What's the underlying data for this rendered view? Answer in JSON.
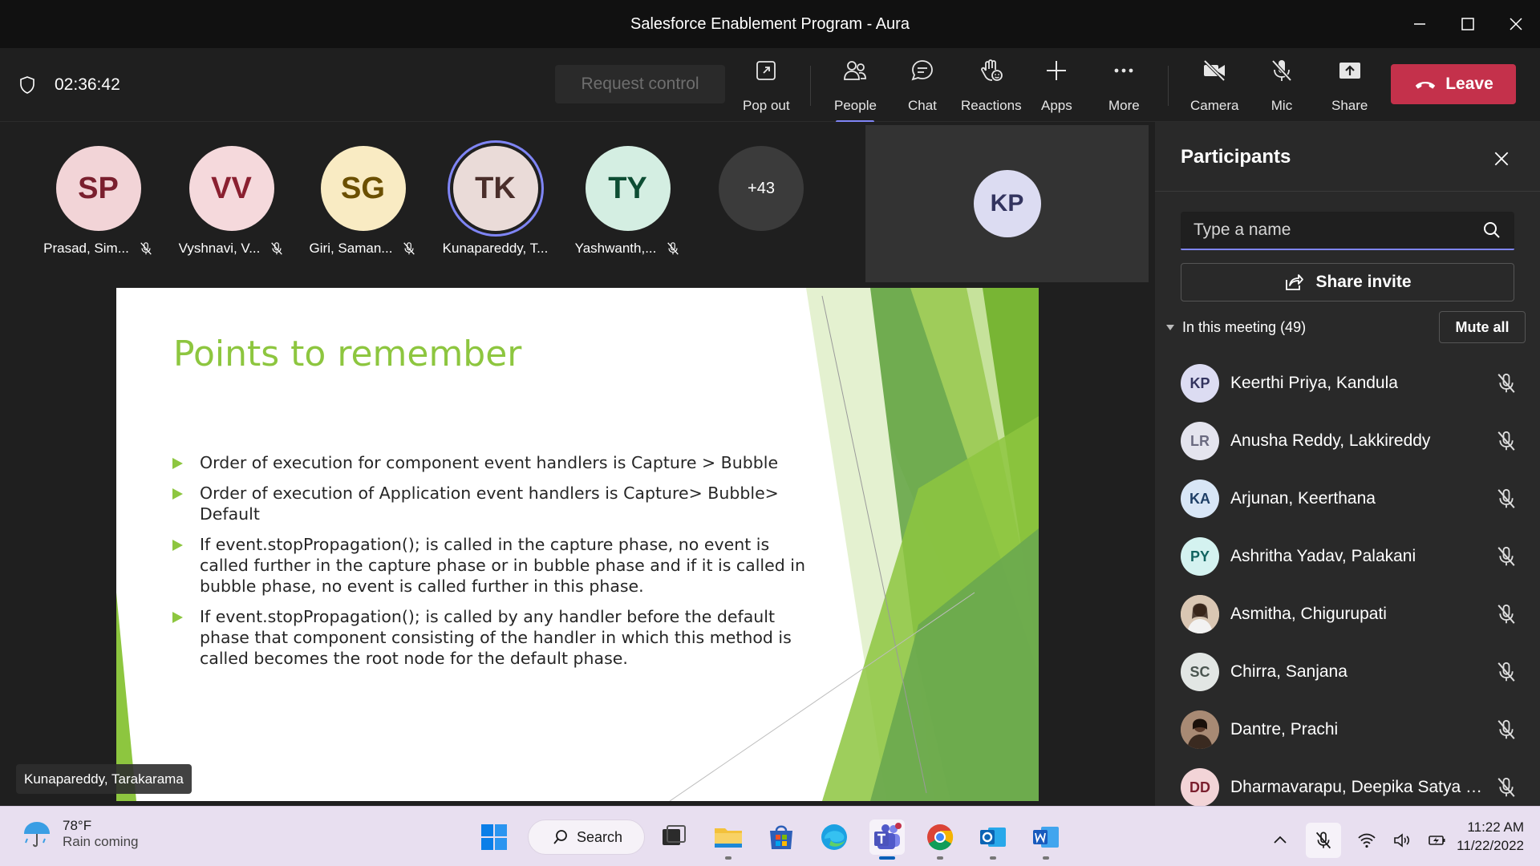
{
  "window": {
    "title": "Salesforce Enablement Program - Aura"
  },
  "toolbar": {
    "timer": "02:36:42",
    "request_control": "Request control",
    "buttons": {
      "pop_out": "Pop out",
      "people": "People",
      "chat": "Chat",
      "reactions": "Reactions",
      "apps": "Apps",
      "more": "More",
      "camera": "Camera",
      "mic": "Mic",
      "share": "Share"
    },
    "leave": "Leave"
  },
  "gallery": {
    "people": [
      {
        "initials": "SP",
        "name": "Prasad, Sim...",
        "bg": "#f2d4d7",
        "fg": "#7a1f2e"
      },
      {
        "initials": "VV",
        "name": "Vyshnavi, V...",
        "bg": "#f5d9dc",
        "fg": "#8a2030"
      },
      {
        "initials": "SG",
        "name": "Giri, Saman...",
        "bg": "#f9ebc3",
        "fg": "#6b4f00"
      },
      {
        "initials": "TK",
        "name": "Kunapareddy, T...",
        "bg": "#eadbd8",
        "fg": "#4a2e2a"
      },
      {
        "initials": "TY",
        "name": "Yashwanth,...",
        "bg": "#d4eee2",
        "fg": "#0d4d33"
      }
    ],
    "overflow": "+43",
    "self_initials": "KP"
  },
  "slide": {
    "title": "Points to remember",
    "bullets": [
      "Order of execution for component event handlers is Capture > Bubble",
      "Order of execution of Application event handlers is Capture> Bubble> Default",
      "If event.stopPropagation(); is called in the capture phase, no event is called further in the capture phase or in bubble phase and if it is called in bubble phase, no event is called further in this phase.",
      "If event.stopPropagation(); is called by any handler before the default phase that component consisting of the handler in which this method is called becomes the root node for the default phase."
    ],
    "accent_color": "#8dc63f",
    "presenter": "Kunapareddy, Tarakarama"
  },
  "participants": {
    "title": "Participants",
    "search_placeholder": "Type a name",
    "share_invite": "Share invite",
    "in_meeting": "In this meeting (49)",
    "mute_all": "Mute all",
    "list": [
      {
        "initials": "KP",
        "name": "Keerthi Priya, Kandula",
        "bg": "#dcdcf2",
        "fg": "#33345f"
      },
      {
        "initials": "LR",
        "name": "Anusha Reddy, Lakkireddy",
        "bg": "#e4e4ee",
        "fg": "#6a6a80"
      },
      {
        "initials": "KA",
        "name": "Arjunan, Keerthana",
        "bg": "#d8e6f6",
        "fg": "#1e3f66"
      },
      {
        "initials": "PY",
        "name": "Ashritha Yadav, Palakani",
        "bg": "#d4f2f0",
        "fg": "#116360"
      },
      {
        "initials": "",
        "name": "Asmitha, Chigurupati",
        "bg": "#c9a98f",
        "fg": "#fff",
        "photo": true
      },
      {
        "initials": "SC",
        "name": "Chirra, Sanjana",
        "bg": "#e2e6e4",
        "fg": "#4a5550"
      },
      {
        "initials": "",
        "name": "Dantre, Prachi",
        "bg": "#8a6a58",
        "fg": "#fff",
        "photo": true
      },
      {
        "initials": "DD",
        "name": "Dharmavarapu, Deepika Satya S...",
        "bg": "#f2d4d7",
        "fg": "#7a1f2e"
      }
    ]
  },
  "taskbar": {
    "weather_temp": "78°F",
    "weather_desc": "Rain coming",
    "search": "Search",
    "time": "11:22 AM",
    "date": "11/22/2022"
  }
}
